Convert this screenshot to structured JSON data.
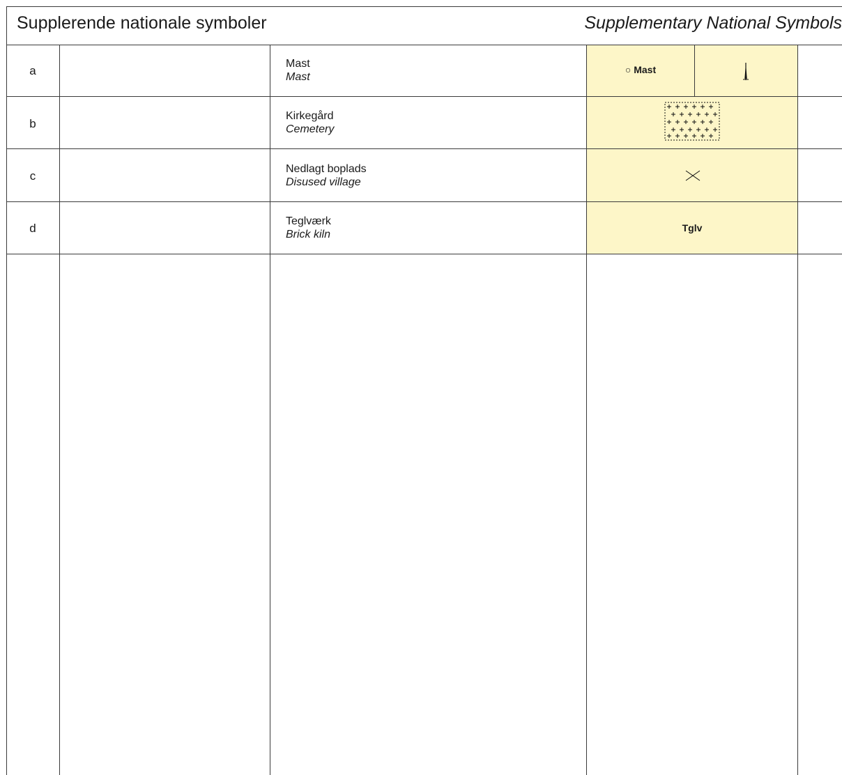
{
  "header": {
    "title_da": "Supplerende nationale symboler",
    "title_en": "Supplementary National Symbols"
  },
  "rows": [
    {
      "letter": "a",
      "name_da": "Mast",
      "name_en": "Mast",
      "symbol_text": "Mast",
      "symbol_icon": "mast-symbol-icon"
    },
    {
      "letter": "b",
      "name_da": "Kirkegård",
      "name_en": "Cemetery",
      "symbol_icon": "cemetery-crosses-icon"
    },
    {
      "letter": "c",
      "name_da": "Nedlagt boplads",
      "name_en": "Disused village",
      "symbol_icon": "cross-x-icon"
    },
    {
      "letter": "d",
      "name_da": "Teglværk",
      "name_en": "Brick kiln",
      "symbol_text": "Tglv"
    }
  ],
  "colors": {
    "symbol_background": "#fdf6c8",
    "rule_lines": "#3a3a3a"
  }
}
